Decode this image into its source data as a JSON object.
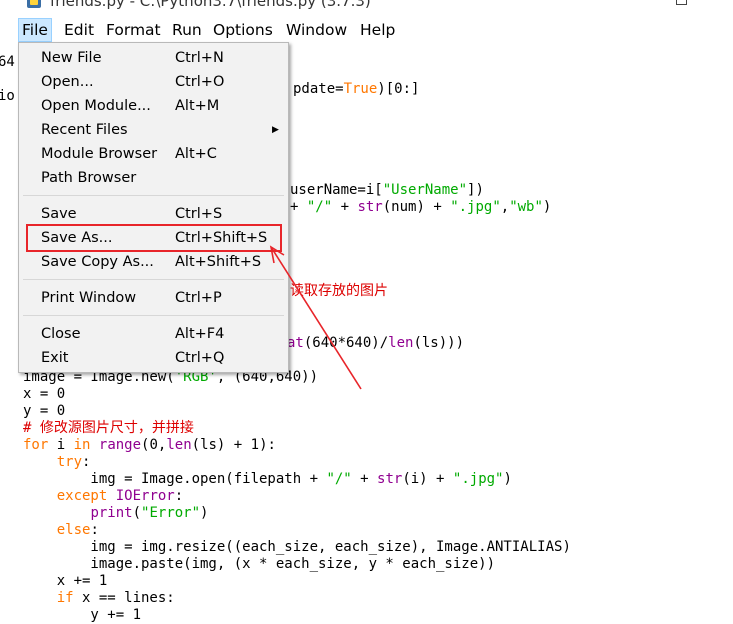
{
  "window": {
    "title": "friends.py - C:\\Python3.7\\friends.py (3.7.3)"
  },
  "menubar": [
    "File",
    "Edit",
    "Format",
    "Run",
    "Options",
    "Window",
    "Help"
  ],
  "file_menu": {
    "groups": [
      [
        {
          "label": "New File",
          "shortcut": "Ctrl+N"
        },
        {
          "label": "Open...",
          "shortcut": "Ctrl+O"
        },
        {
          "label": "Open Module...",
          "shortcut": "Alt+M"
        },
        {
          "label": "Recent Files",
          "shortcut": "",
          "submenu": true
        },
        {
          "label": "Module Browser",
          "shortcut": "Alt+C"
        },
        {
          "label": "Path Browser",
          "shortcut": ""
        }
      ],
      [
        {
          "label": "Save",
          "shortcut": "Ctrl+S"
        },
        {
          "label": "Save As...",
          "shortcut": "Ctrl+Shift+S",
          "highlighted": true
        },
        {
          "label": "Save Copy As...",
          "shortcut": "Alt+Shift+S"
        }
      ],
      [
        {
          "label": "Print Window",
          "shortcut": "Ctrl+P"
        }
      ],
      [
        {
          "label": "Close",
          "shortcut": "Alt+F4"
        },
        {
          "label": "Exit",
          "shortcut": "Ctrl+Q"
        }
      ]
    ]
  },
  "code": {
    "partial_left": [
      "64",
      "io"
    ],
    "partial_lines": [
      [
        [
          "pdate=",
          ""
        ],
        [
          "True",
          "kw"
        ],
        [
          ")[0:]",
          ""
        ]
      ],
      [
        [
          "userName=i[",
          ""
        ],
        [
          "\"UserName\"",
          "st"
        ],
        [
          "])",
          ""
        ]
      ],
      [
        [
          "+ ",
          ""
        ],
        [
          "\"/\"",
          "st"
        ],
        [
          " + ",
          ""
        ],
        [
          "str",
          "bi"
        ],
        [
          "(num) + ",
          ""
        ],
        [
          "\".jpg\"",
          "st"
        ],
        [
          ",",
          ""
        ],
        [
          "\"wb\"",
          "st"
        ],
        [
          ")",
          ""
        ]
      ],
      [
        [
          "读取存放的图片",
          "cm"
        ]
      ],
      [
        [
          "at",
          "bi"
        ],
        [
          "(640*640)/",
          ""
        ],
        [
          "len",
          "bi"
        ],
        [
          "(ls)))",
          ""
        ]
      ]
    ],
    "lines": [
      [
        [
          "image = Image.new(",
          ""
        ],
        [
          "'RGB'",
          "st"
        ],
        [
          ", (640,640))",
          ""
        ]
      ],
      [
        [
          "x = 0",
          ""
        ]
      ],
      [
        [
          "y = 0",
          ""
        ]
      ],
      [
        [
          "# 修改源图片尺寸，并拼接",
          "cm"
        ]
      ],
      [
        [
          "for",
          "kw"
        ],
        [
          " i ",
          ""
        ],
        [
          "in",
          "kw"
        ],
        [
          " ",
          ""
        ],
        [
          "range",
          "bi"
        ],
        [
          "(0,",
          ""
        ],
        [
          "len",
          "bi"
        ],
        [
          "(ls) + 1):",
          ""
        ]
      ],
      [
        [
          "    ",
          ""
        ],
        [
          "try",
          "kw"
        ],
        [
          ":",
          ""
        ]
      ],
      [
        [
          "        img = Image.open(filepath + ",
          ""
        ],
        [
          "\"/\"",
          "st"
        ],
        [
          " + ",
          ""
        ],
        [
          "str",
          "bi"
        ],
        [
          "(i) + ",
          ""
        ],
        [
          "\".jpg\"",
          "st"
        ],
        [
          ")",
          ""
        ]
      ],
      [
        [
          "    ",
          ""
        ],
        [
          "except",
          "kw"
        ],
        [
          " ",
          ""
        ],
        [
          "IOError",
          "bi"
        ],
        [
          ":",
          ""
        ]
      ],
      [
        [
          "        ",
          ""
        ],
        [
          "print",
          "bi"
        ],
        [
          "(",
          ""
        ],
        [
          "\"Error\"",
          "st"
        ],
        [
          ")",
          ""
        ]
      ],
      [
        [
          "    ",
          ""
        ],
        [
          "else",
          "kw"
        ],
        [
          ":",
          ""
        ]
      ],
      [
        [
          "        img = img.resize((each_size, each_size), Image.ANTIALIAS)",
          ""
        ]
      ],
      [
        [
          "        image.paste(img, (x * each_size, y * each_size))",
          ""
        ]
      ],
      [
        [
          "    x += 1",
          ""
        ]
      ],
      [
        [
          "    ",
          ""
        ],
        [
          "if",
          "kw"
        ],
        [
          " x == lines:",
          ""
        ]
      ],
      [
        [
          "        y += 1",
          ""
        ]
      ]
    ]
  },
  "colors": {
    "keyword": "#ff7700",
    "string": "#00aa00",
    "builtin": "#900090",
    "comment": "#dd0000",
    "annotation": "#e8252a",
    "menu_bg": "#f2f2f2",
    "active_menu_bg": "#cce8ff"
  }
}
